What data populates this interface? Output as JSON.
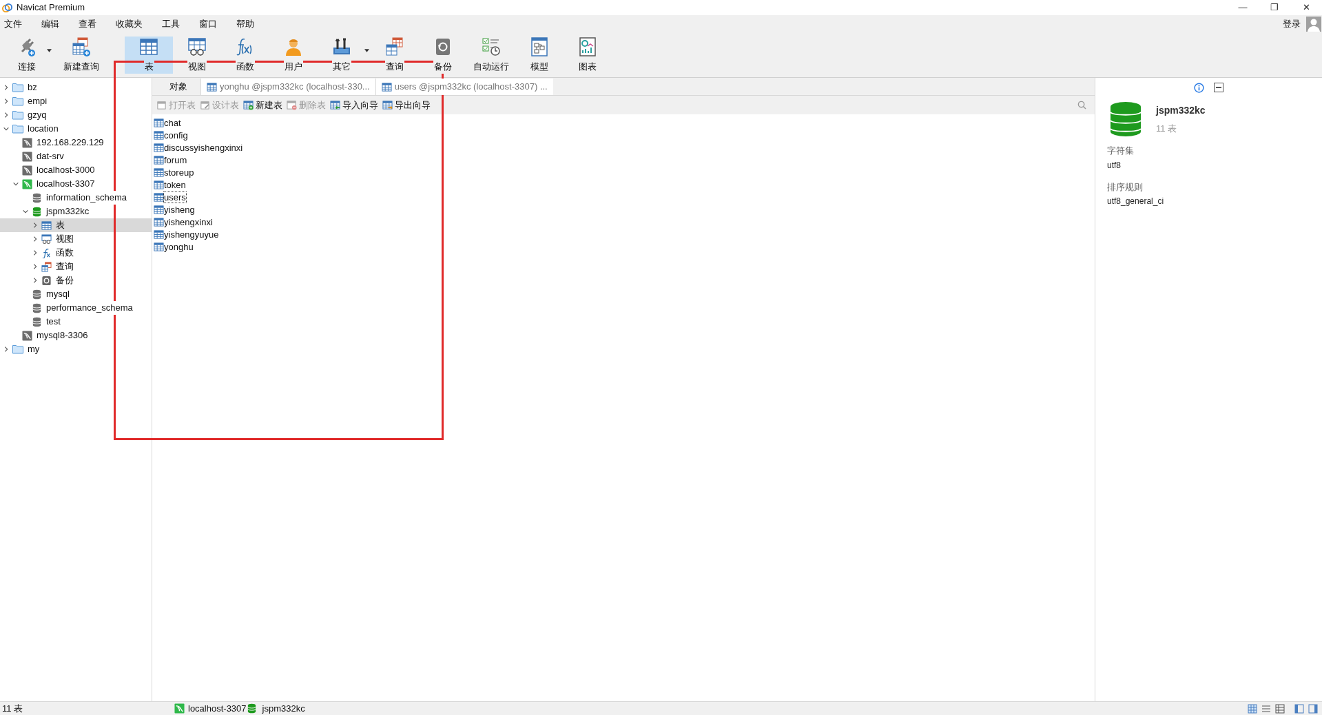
{
  "window": {
    "title": "Navicat Premium",
    "controls": [
      "—",
      "❐",
      "✕"
    ]
  },
  "menu": [
    "文件",
    "编辑",
    "查看",
    "收藏夹",
    "工具",
    "窗口",
    "帮助"
  ],
  "login": "登录",
  "toolbar": [
    {
      "label": "连接",
      "selected": false,
      "dropdown": true
    },
    {
      "label": "新建查询",
      "selected": false,
      "dropdown": false
    },
    {
      "label": "表",
      "selected": true,
      "dropdown": false
    },
    {
      "label": "视图",
      "selected": false,
      "dropdown": false
    },
    {
      "label": "函数",
      "selected": false,
      "dropdown": false
    },
    {
      "label": "用户",
      "selected": false,
      "dropdown": false
    },
    {
      "label": "其它",
      "selected": false,
      "dropdown": true
    },
    {
      "label": "查询",
      "selected": false,
      "dropdown": false
    },
    {
      "label": "备份",
      "selected": false,
      "dropdown": false
    },
    {
      "label": "自动运行",
      "selected": false,
      "dropdown": false
    },
    {
      "label": "模型",
      "selected": false,
      "dropdown": false
    },
    {
      "label": "图表",
      "selected": false,
      "dropdown": false
    }
  ],
  "tree": [
    {
      "label": "bz",
      "kind": "folder",
      "expanded": false,
      "selected": false
    },
    {
      "label": "empi",
      "kind": "folder",
      "expanded": false,
      "selected": false
    },
    {
      "label": "gzyq",
      "kind": "folder",
      "expanded": false,
      "selected": false
    },
    {
      "label": "location",
      "kind": "folder",
      "expanded": true,
      "selected": false,
      "children": [
        {
          "label": "192.168.229.129",
          "kind": "server",
          "active": false,
          "selected": false
        },
        {
          "label": "dat-srv",
          "kind": "server",
          "active": false,
          "selected": false
        },
        {
          "label": "localhost-3000",
          "kind": "server",
          "active": false,
          "selected": false
        },
        {
          "label": "localhost-3307",
          "kind": "server",
          "active": true,
          "expanded": true,
          "selected": false,
          "children": [
            {
              "label": "information_schema",
              "kind": "database",
              "active": false,
              "selected": false
            },
            {
              "label": "jspm332kc",
              "kind": "database",
              "active": true,
              "expanded": true,
              "selected": false,
              "children": [
                {
                  "label": "表",
                  "kind": "table",
                  "expanded": false,
                  "selected": true
                },
                {
                  "label": "视图",
                  "kind": "view",
                  "expanded": false,
                  "selected": false
                },
                {
                  "label": "函数",
                  "kind": "function",
                  "expanded": false,
                  "selected": false
                },
                {
                  "label": "查询",
                  "kind": "query",
                  "expanded": false,
                  "selected": false
                },
                {
                  "label": "备份",
                  "kind": "backup",
                  "expanded": false,
                  "selected": false
                }
              ]
            },
            {
              "label": "mysql",
              "kind": "database",
              "active": false,
              "selected": false
            },
            {
              "label": "performance_schema",
              "kind": "database",
              "active": false,
              "selected": false
            },
            {
              "label": "test",
              "kind": "database",
              "active": false,
              "selected": false
            }
          ]
        },
        {
          "label": "mysql8-3306",
          "kind": "server",
          "active": false,
          "selected": false
        }
      ]
    },
    {
      "label": "my",
      "kind": "folder",
      "expanded": false,
      "selected": false
    }
  ],
  "tabs": [
    {
      "label": "对象",
      "kind": "objects",
      "selected": true
    },
    {
      "label": "yonghu @jspm332kc (localhost-330...",
      "kind": "table",
      "selected": false
    },
    {
      "label": "users @jspm332kc (localhost-3307) ...",
      "kind": "table",
      "selected": false
    }
  ],
  "actions": [
    {
      "label": "打开表",
      "disabled": true
    },
    {
      "label": "设计表",
      "disabled": true
    },
    {
      "label": "新建表",
      "disabled": false
    },
    {
      "label": "删除表",
      "disabled": true
    },
    {
      "label": "导入向导",
      "disabled": false
    },
    {
      "label": "导出向导",
      "disabled": false
    }
  ],
  "tables": [
    {
      "name": "chat",
      "selected": false
    },
    {
      "name": "config",
      "selected": false
    },
    {
      "name": "discussyishengxinxi",
      "selected": false
    },
    {
      "name": "forum",
      "selected": false
    },
    {
      "name": "storeup",
      "selected": false
    },
    {
      "name": "token",
      "selected": false
    },
    {
      "name": "users",
      "selected": true
    },
    {
      "name": "yisheng",
      "selected": false
    },
    {
      "name": "yishengxinxi",
      "selected": false
    },
    {
      "name": "yishengyuyue",
      "selected": false
    },
    {
      "name": "yonghu",
      "selected": false
    }
  ],
  "info_panel": {
    "name": "jspm332kc",
    "count": "11 表",
    "fields": [
      {
        "label": "字符集",
        "value": "utf8"
      },
      {
        "label": "排序规则",
        "value": "utf8_general_ci"
      }
    ]
  },
  "status_bar": {
    "count": "11 表",
    "connection": "localhost-3307",
    "database": "jspm332kc"
  }
}
